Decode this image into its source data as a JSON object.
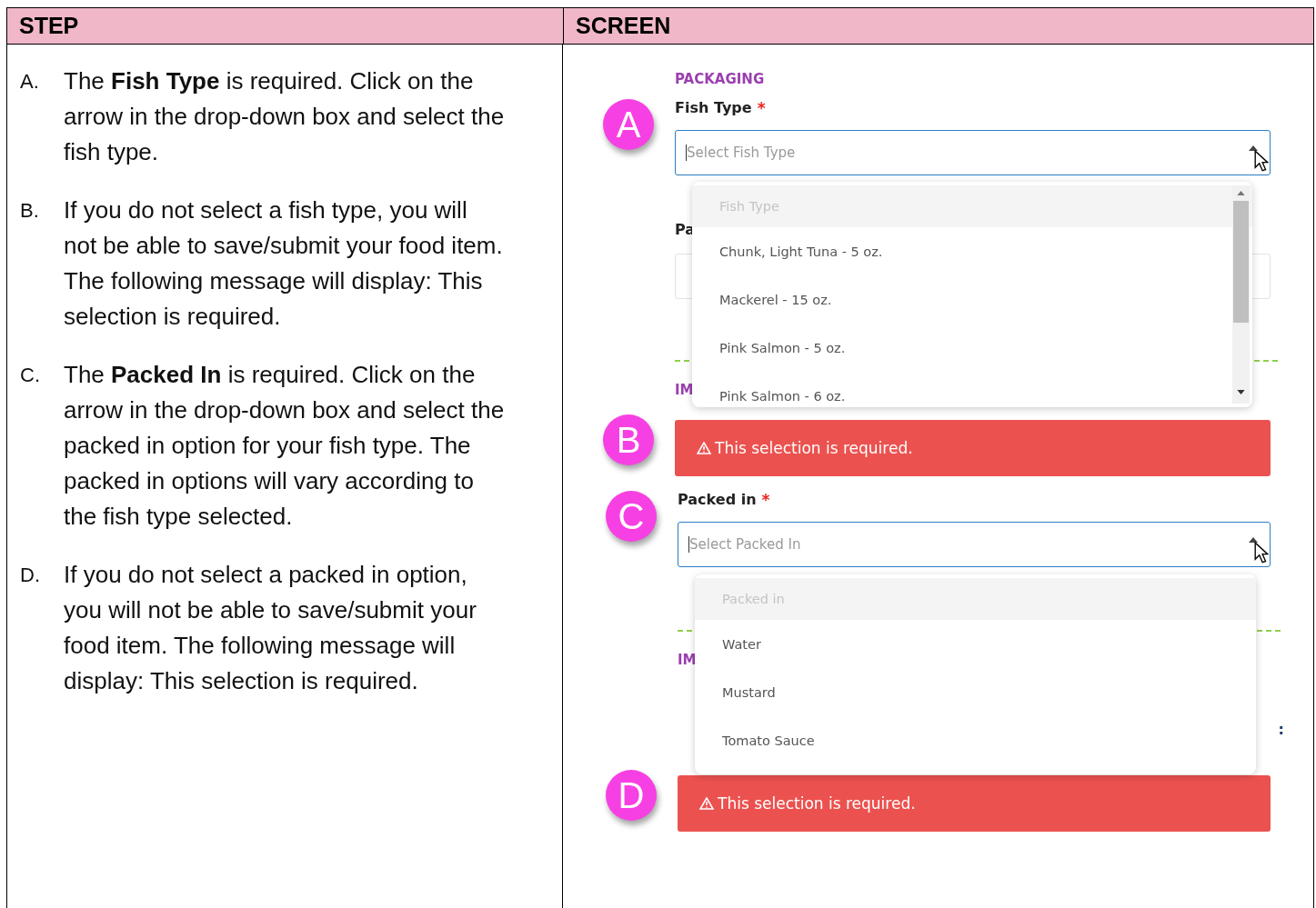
{
  "table": {
    "columns": [
      "STEP",
      "SCREEN"
    ]
  },
  "steps": [
    {
      "letter": "A.",
      "text": "The **Fish Type** is required. Click on the arrow in the drop-down box and select the fish type."
    },
    {
      "letter": "B.",
      "text": "If you do not select a fish type, you will not be able to save/submit your food item.  The following message will display:  This selection is required."
    },
    {
      "letter": "C.",
      "text": "The **Packed In** is required.  Click on the arrow in the drop-down box and select the packed in option for your fish type. The packed in options will vary according to the fish type selected."
    },
    {
      "letter": "D.",
      "text": "If you do not select a packed in option, you will not be able to save/submit your food item.  The following message will display: This selection is required."
    }
  ],
  "screen": {
    "section_title": "PACKAGING",
    "fish_type": {
      "badge": "A",
      "label": "Fish Type",
      "required_mark": "*",
      "placeholder": "Select Fish Type",
      "open": true,
      "scrollable": true,
      "options": [
        {
          "kind": "placeholder",
          "label": "Fish Type"
        },
        {
          "kind": "option",
          "label": "Chunk, Light Tuna - 5 oz."
        },
        {
          "kind": "option",
          "label": "Mackerel - 15 oz."
        },
        {
          "kind": "option",
          "label": "Pink Salmon - 5 oz."
        },
        {
          "kind": "option",
          "label": "Pink Salmon - 6 oz."
        }
      ]
    },
    "behind_first": {
      "label": "Pa",
      "section": "IM"
    },
    "fish_type_error": {
      "badge": "B",
      "message": "This selection is required."
    },
    "packed_in": {
      "badge": "C",
      "label": "Packed in",
      "required_mark": "*",
      "placeholder": "Select Packed In",
      "open": true,
      "scrollable": false,
      "options": [
        {
          "kind": "placeholder",
          "label": "Packed in"
        },
        {
          "kind": "option",
          "label": "Water"
        },
        {
          "kind": "option",
          "label": "Mustard"
        },
        {
          "kind": "option",
          "label": "Tomato Sauce"
        }
      ]
    },
    "behind_second": {
      "section": "IM",
      "mark": ":"
    },
    "packed_in_error": {
      "badge": "D",
      "message": "This selection is required."
    }
  }
}
